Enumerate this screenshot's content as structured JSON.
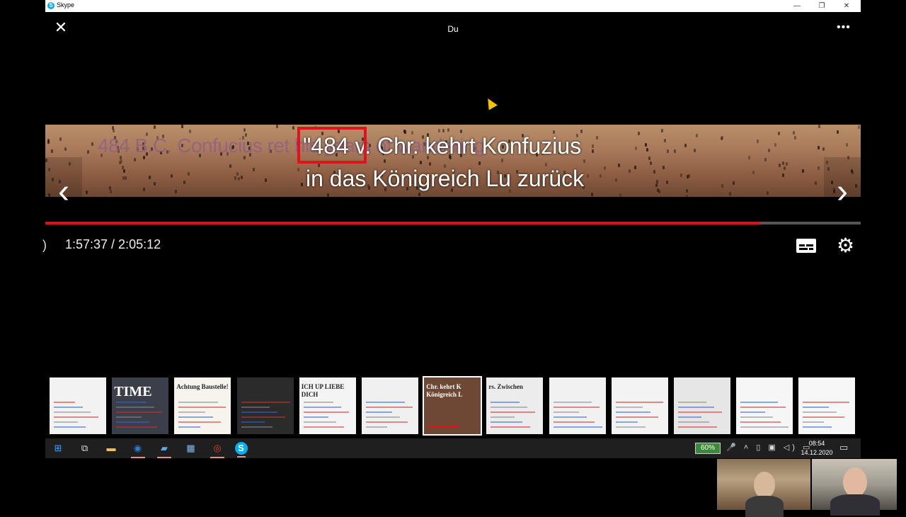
{
  "window": {
    "app_title": "Skype",
    "app_icon_letter": "S",
    "minimize": "—",
    "restore": "❐",
    "close": "✕"
  },
  "viewer": {
    "title": "Du",
    "close_glyph": "✕",
    "more_glyph": "•••"
  },
  "image": {
    "subtitle_en": "484 B.C. Confucius ret           his years of wandering",
    "subtitle_de_line1": "\"484 v. Chr. kehrt Konfuzius",
    "subtitle_de_line2": "in das Königreich Lu zurück",
    "highlight_color": "#e0131b"
  },
  "nav": {
    "prev_glyph": "‹",
    "next_glyph": "›"
  },
  "video": {
    "time_display": "1:57:37 / 2:05:12",
    "progress_fraction": 0.8768,
    "gear_glyph": "⚙",
    "edge_glyph": ")"
  },
  "thumbnails": [
    {
      "label": "",
      "active": false,
      "bg": "#f2f2f2"
    },
    {
      "label": "TIME",
      "active": false,
      "bg": "#3b3f4a"
    },
    {
      "label": "Achtung Baustelle!",
      "active": false,
      "bg": "#f7f4ee"
    },
    {
      "label": "",
      "active": false,
      "bg": "#2b2b2b"
    },
    {
      "label": "ICH UP LIEBE DICH",
      "active": false,
      "bg": "#f4f4f4"
    },
    {
      "label": "",
      "active": false,
      "bg": "#f0f0f0"
    },
    {
      "label": "Chr. kehrt K Königreich L",
      "active": true,
      "bg": "#6e4834"
    },
    {
      "label": "rs. Zwischen",
      "active": false,
      "bg": "#ececec"
    },
    {
      "label": "",
      "active": false,
      "bg": "#f1f1f1"
    },
    {
      "label": "",
      "active": false,
      "bg": "#f3f3f3"
    },
    {
      "label": "",
      "active": false,
      "bg": "#e6e6e6"
    },
    {
      "label": "",
      "active": false,
      "bg": "#f6f6f6"
    },
    {
      "label": "",
      "active": false,
      "bg": "#f7f7f7"
    }
  ],
  "taskbar": {
    "battery": "60%",
    "clock_time": "08:54",
    "clock_date": "14.12.2020",
    "apps": [
      {
        "name": "start",
        "glyph": "⊞",
        "color": "#3fa4ff"
      },
      {
        "name": "task-view",
        "glyph": "⧉",
        "color": "#ddd"
      },
      {
        "name": "file-explorer",
        "glyph": "▬",
        "color": "#f3c443"
      },
      {
        "name": "outlook",
        "glyph": "◉",
        "color": "#2b7cd3"
      },
      {
        "name": "notepad",
        "glyph": "▰",
        "color": "#5aa9e6"
      },
      {
        "name": "calculator",
        "glyph": "▦",
        "color": "#7fb8f0"
      },
      {
        "name": "chrome",
        "glyph": "◎",
        "color": "#e34133"
      },
      {
        "name": "skype",
        "glyph": "S",
        "color": "#00aff0"
      }
    ],
    "tray_glyphs": "🎤 ˄ ▯ ▣ ◁) ▭",
    "notif_glyph": "▭"
  }
}
